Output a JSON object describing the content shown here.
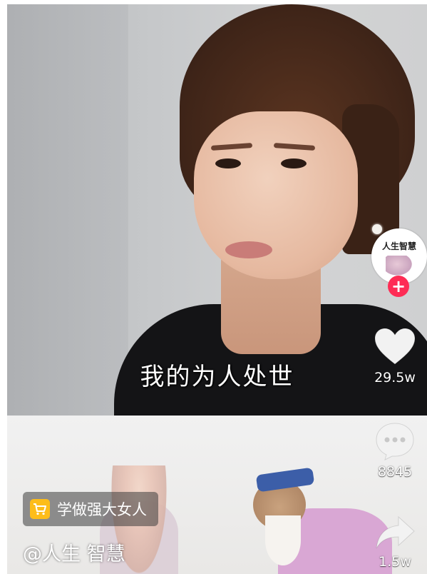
{
  "video": {
    "subtitle": "我的为人处世"
  },
  "creator": {
    "avatar_text": "人生智慧",
    "handle": "@人生 智慧"
  },
  "actions": {
    "likes": "29.5w",
    "comments": "8845",
    "shares": "1.5w"
  },
  "shop": {
    "label": "学做强大女人"
  },
  "colors": {
    "follow": "#fe2c55",
    "cart": "#fdbd1a"
  },
  "icons": [
    "heart-icon",
    "comment-icon",
    "share-icon",
    "cart-icon",
    "plus-icon"
  ]
}
